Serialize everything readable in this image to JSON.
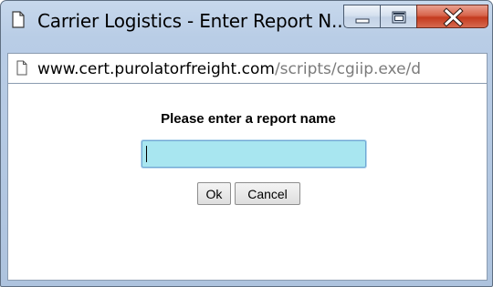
{
  "window": {
    "title": "Carrier Logistics - Enter Report N...",
    "icons": {
      "title": "page-icon",
      "minimize": "minimize-icon",
      "maximize": "maximize-icon",
      "close": "close-icon"
    }
  },
  "address_bar": {
    "host": "www.cert.purolatorfreight.com",
    "path": "/scripts/cgiip.exe/d",
    "icon": "page-icon"
  },
  "form": {
    "prompt": "Please enter a report name",
    "report_name_value": "",
    "ok_label": "Ok",
    "cancel_label": "Cancel"
  },
  "colors": {
    "input_background": "#a8e6f0",
    "close_button": "#c43a1e",
    "window_frame": "#b9cde6"
  }
}
